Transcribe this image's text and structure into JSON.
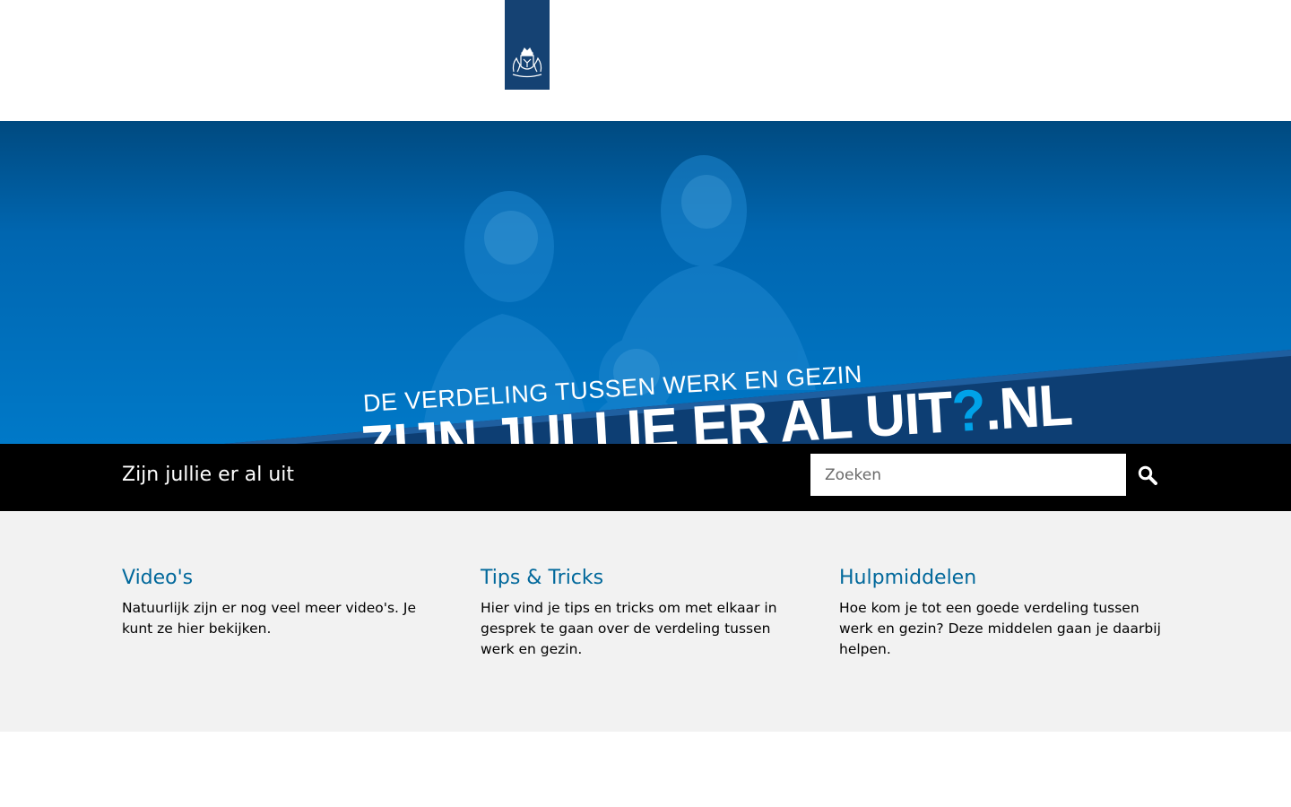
{
  "header": {
    "logo_alt": "Rijksoverheid",
    "logo_icon": "coat-of-arms-icon",
    "logo_color": "#154273"
  },
  "hero": {
    "tagline": "DE VERDELING TUSSEN WERK EN GEZIN",
    "headline_main": "ZIJN JULLIE ER AL UIT",
    "headline_q": "?",
    "headline_tld": ".NL",
    "accent_color": "#0079c8"
  },
  "subbar": {
    "site_title": "Zijn jullie er al uit",
    "search_placeholder": "Zoeken",
    "search_icon": "search-icon"
  },
  "sections": [
    {
      "title": "Video's",
      "text": "Natuurlijk zijn er nog veel meer video's. Je kunt ze hier bekijken."
    },
    {
      "title": "Tips & Tricks",
      "text": "Hier vind je tips en tricks om met elkaar in gesprek te gaan over de verdeling tussen werk en gezin."
    },
    {
      "title": "Hulpmiddelen",
      "text": "Hoe kom je tot een goede verdeling tussen werk en gezin? Deze middelen gaan je daarbij helpen."
    }
  ],
  "colors": {
    "link": "#01689b",
    "band": "#f2f2f2",
    "subbar": "#000000"
  }
}
